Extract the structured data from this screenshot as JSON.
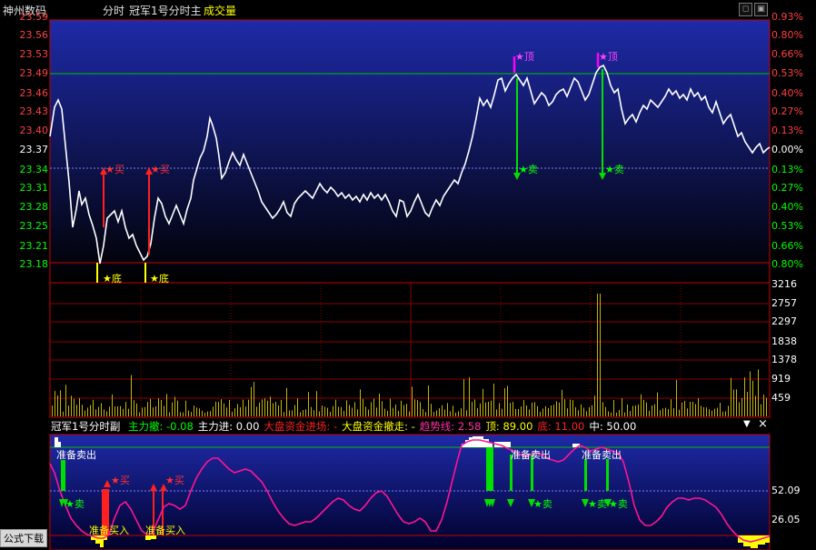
{
  "header": {
    "stock_name": "神州数码",
    "view": "分时",
    "indicator_main": "冠军1号分时主",
    "volume_label": "成交量"
  },
  "price_axis": {
    "left": [
      "23.59",
      "23.56",
      "23.53",
      "23.49",
      "23.46",
      "23.43",
      "23.40",
      "23.37",
      "23.34",
      "23.31",
      "23.28",
      "23.25",
      "23.21",
      "23.18"
    ],
    "right": [
      "0.93%",
      "0.80%",
      "0.66%",
      "0.53%",
      "0.40%",
      "0.27%",
      "0.13%",
      "0.00%",
      "0.13%",
      "0.27%",
      "0.40%",
      "0.53%",
      "0.66%",
      "0.80%"
    ]
  },
  "volume_axis": [
    "3216",
    "2757",
    "2297",
    "1838",
    "1378",
    "919",
    "459"
  ],
  "indicator_axis": [
    "52.09",
    "26.05"
  ],
  "sub_panel": {
    "name": "冠军1号分时副",
    "items": [
      {
        "label": "主力撤:",
        "value": "-0.08",
        "color": "#00ff00"
      },
      {
        "label": "主力进:",
        "value": "0.00",
        "color": "#ffffff"
      },
      {
        "label": "大盘资金进场:",
        "value": "-",
        "color": "#ff2020"
      },
      {
        "label": "大盘资金撤走:",
        "value": "-",
        "color": "#ffff00"
      },
      {
        "label": "趋势线:",
        "value": "2.58",
        "color": "#ff30a0"
      },
      {
        "label": "顶:",
        "value": "89.00",
        "color": "#ffff00"
      },
      {
        "label": "底:",
        "value": "11.00",
        "color": "#ff2020"
      },
      {
        "label": "中:",
        "value": "50.00",
        "color": "#ffffff"
      }
    ]
  },
  "signals": {
    "top": "★顶",
    "bottom": "★底",
    "buy": "★买",
    "sell": "★卖",
    "prepare_sell": "准备卖出",
    "prepare_buy": "准备买入"
  },
  "buttons": {
    "formula_download": "公式下载",
    "collapse": "▼",
    "close": "×"
  },
  "colors": {
    "up": "#ff3030",
    "down": "#00e000",
    "price_line": "#ffffff",
    "trend_line": "#ff1493",
    "volume_bar": "#c8b400",
    "panel_bg_top": "#1e2aa8",
    "panel_bg_bottom": "#000000"
  }
}
